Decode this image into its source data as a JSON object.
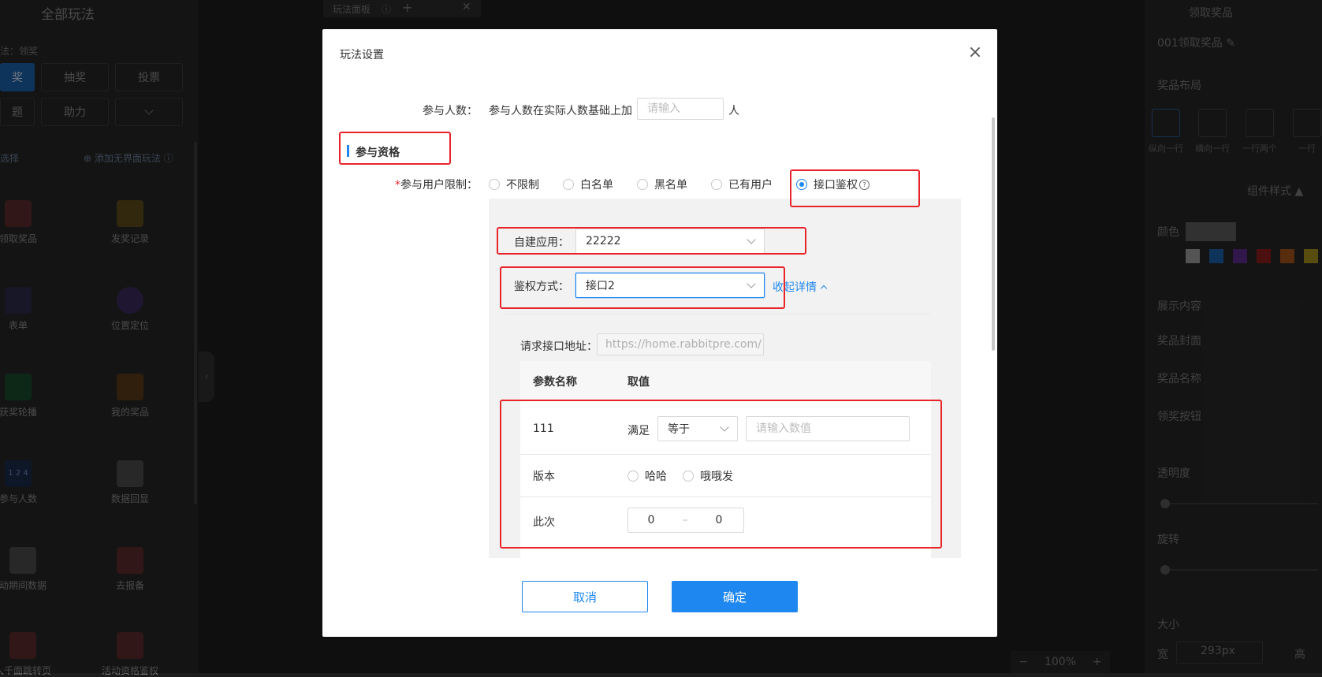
{
  "background": {
    "left_panel": {
      "title": "全部玩法",
      "subtitle": "法：领奖",
      "tabs": [
        "奖",
        "抽奖",
        "投票",
        "题",
        "助力"
      ],
      "select_label": "选择",
      "add_link": "添加无界面玩法",
      "items": [
        "领取奖品",
        "发奖记录",
        "表单",
        "位置定位",
        "获奖轮播",
        "我的奖品",
        "参与人数",
        "数据回显",
        "动期间数据",
        "去报备",
        "人千面跳转页",
        "活动资格鉴权"
      ],
      "tile_texts": [
        "1",
        "2",
        "4"
      ]
    },
    "canvas": {
      "tab_label": "玩法面板",
      "zoom": "100%",
      "zoom_minus": "−",
      "zoom_plus": "+"
    },
    "right_panel": {
      "title": "领取奖品",
      "component_name": "001领取奖品",
      "layout_label": "奖品布局",
      "layouts": [
        "纵向一行",
        "横向一行",
        "一行两个",
        "一行"
      ],
      "style_label": "组件样式",
      "color_label": "颜色",
      "display_label": "展示内容",
      "display_items": [
        "奖品封面",
        "奖品名称",
        "领奖按钮"
      ],
      "opacity_label": "透明度",
      "rotate_label": "旋转",
      "size_label": "大小",
      "width_label": "宽",
      "width_value": "293px",
      "height_label": "高",
      "swatches": [
        "#9a9a9a",
        "#1d5fa6",
        "#5a2a8a",
        "#8a1c1c",
        "#a0521a",
        "#a08a1a"
      ]
    }
  },
  "dialog": {
    "title": "玩法设置",
    "participants": {
      "label": "参与人数：",
      "description": "参与人数在实际人数基础上加",
      "placeholder": "请输入",
      "unit": "人"
    },
    "section_title": "参与资格",
    "user_limit": {
      "required_mark": "*",
      "label": "参与用户限制：",
      "options": [
        "不限制",
        "白名单",
        "黑名单",
        "已有用户",
        "接口鉴权"
      ],
      "selected": "接口鉴权"
    },
    "self_app": {
      "label": "自建应用：",
      "value": "22222"
    },
    "auth_method": {
      "label": "鉴权方式：",
      "value": "接口2"
    },
    "collapse_link": "收起详情",
    "request_url": {
      "label": "请求接口地址：",
      "value": "https://home.rabbitpre.com/"
    },
    "param_table": {
      "headers": [
        "参数名称",
        "取值"
      ],
      "rows": [
        {
          "name": "111",
          "condition_label": "满足",
          "operator": "等于",
          "value_placeholder": "请输入数值"
        },
        {
          "name": "版本",
          "options": [
            "哈哈",
            "哦哦发"
          ]
        },
        {
          "name": "此次",
          "range_from": "0",
          "range_sep": "–",
          "range_to": "0"
        }
      ]
    },
    "buttons": {
      "cancel": "取消",
      "ok": "确定"
    }
  },
  "colors": {
    "primary": "#1e87f0",
    "annotation_red": "#e8242b"
  }
}
